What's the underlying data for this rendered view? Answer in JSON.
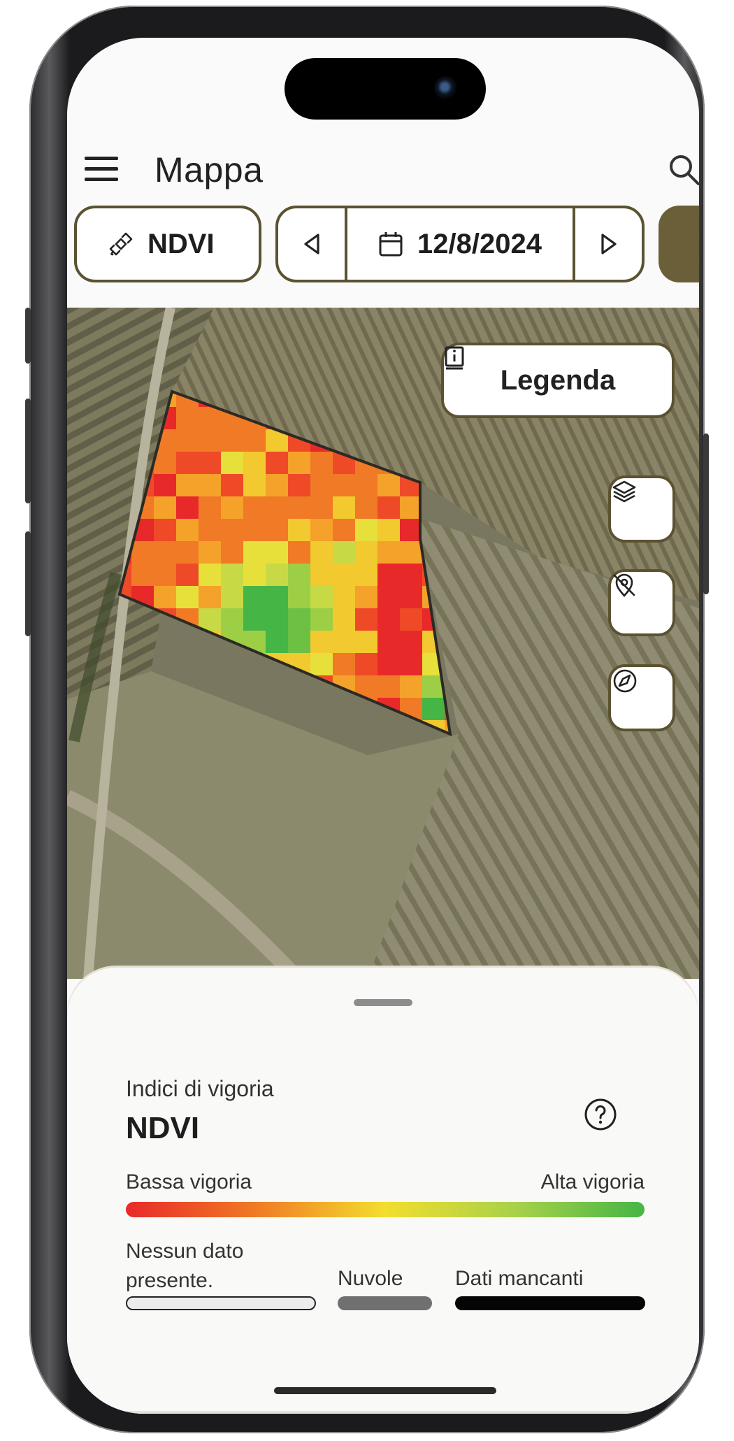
{
  "header": {
    "title": "Mappa",
    "menu_icon": "hamburger-menu-icon",
    "search_icon": "search-icon"
  },
  "toolbar": {
    "index_chip": {
      "label": "NDVI",
      "icon": "satellite-icon"
    },
    "date_chip": {
      "value": "12/8/2024",
      "icon": "calendar-icon",
      "prev_icon": "triangle-left-icon",
      "next_icon": "triangle-right-icon"
    }
  },
  "map": {
    "legend_button": {
      "label": "Legenda",
      "icon": "info-book-icon"
    },
    "controls": [
      "layers-icon",
      "visibility-off-icon",
      "compass-icon"
    ]
  },
  "legend_sheet": {
    "subtitle": "Indici di vigoria",
    "index_name": "NDVI",
    "help_icon": "help-circle-icon",
    "low_label": "Bassa vigoria",
    "high_label": "Alta vigoria",
    "no_data_label": "Nessun dato presente.",
    "clouds_label": "Nuvole",
    "missing_label": "Dati mancanti"
  },
  "colors": {
    "accent": "#5b5231",
    "low": "#e8292a",
    "mid": "#f2de2e",
    "high": "#45b545",
    "clouds": "#707070",
    "missing": "#050505"
  }
}
